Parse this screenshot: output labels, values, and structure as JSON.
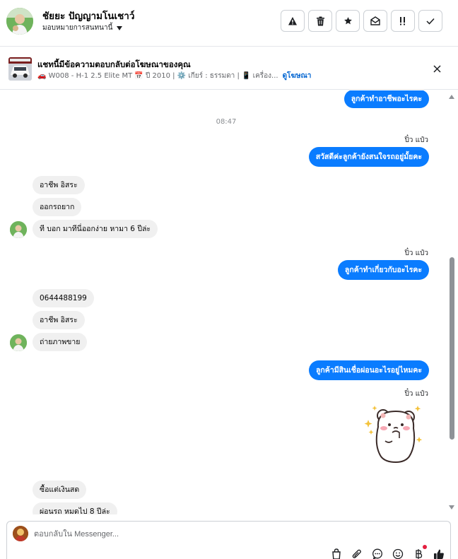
{
  "header": {
    "contact_name": "ชัยยะ ปัญญามโนเชาว์",
    "assign_label": "มอบหมายการสนทนานี้",
    "actions": [
      {
        "icon": "warning-icon"
      },
      {
        "icon": "trash-icon"
      },
      {
        "icon": "star-icon"
      },
      {
        "icon": "mark-unread-icon"
      },
      {
        "icon": "follow-up-icon"
      },
      {
        "icon": "done-check-icon"
      }
    ]
  },
  "ad": {
    "title": "แชทนี้มีข้อความตอบกลับต่อโฆษณาของคุณ",
    "detail": "🚗 W008 - H-1 2.5 Elite MT 📅 ปี 2010 | ⚙️ เกียร์ : ธรรมดา | 📱 เครื่อง...",
    "link": "ดูโฆษณา"
  },
  "chat": {
    "msg_top": "ลูกค้าทำอาชีพอะไรคะ",
    "time": "08:47",
    "sender_1": "ปิ๋ว แป๋ว",
    "msg_greeting": "สวัสดีค่ะลูกค้ายังสนใจรถอยู่มั้ยคะ",
    "in_1": "อาชีพ อิสระ",
    "in_2": "ออกรถยาก",
    "in_3": "ที บอก มาทีนี่ออกง่าย  หามา 6 ปีล่ะ",
    "sender_2": "ปิ๋ว แป๋ว",
    "msg_job": "ลูกค้าทำเกี่ยวกับอะไรคะ",
    "in_4": "0644488199",
    "in_5": "อาชีพ อิสระ",
    "in_6": "ถ่ายภาพขาย",
    "msg_credit": "ลูกค้ามีสินเชื่อผ่อนอะไรอยู่ไหมคะ",
    "sender_3": "ปิ๋ว แป๋ว",
    "in_7": "ซื้อแต่เงินสด",
    "in_8": "ผ่อนรถ หมดไป  8 ปีล่ะ"
  },
  "composer": {
    "placeholder": "ตอบกลับใน Messenger..."
  },
  "colors": {
    "outgoing_bubble": "#0a7cff",
    "incoming_bubble": "#f0f0f0",
    "link": "#0064d1"
  }
}
